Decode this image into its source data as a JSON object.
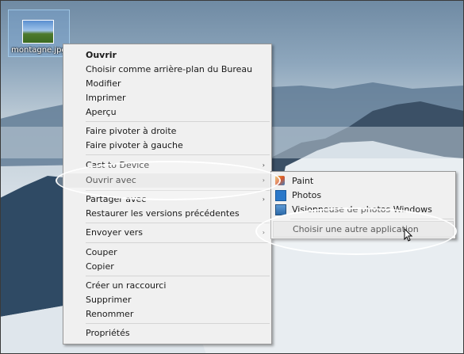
{
  "desktop": {
    "icon_label": "montagne.jpg"
  },
  "context_menu": {
    "items": [
      {
        "label": "Ouvrir",
        "bold": true
      },
      {
        "label": "Choisir comme arrière-plan du Bureau"
      },
      {
        "label": "Modifier"
      },
      {
        "label": "Imprimer"
      },
      {
        "label": "Aperçu"
      },
      {
        "label": "Faire pivoter à droite"
      },
      {
        "label": "Faire pivoter à gauche"
      },
      {
        "label": "Cast to Device",
        "submenu": true
      },
      {
        "label": "Ouvrir avec",
        "submenu": true,
        "highlighted": true
      },
      {
        "label": "Partager avec",
        "submenu": true
      },
      {
        "label": "Restaurer les versions précédentes"
      },
      {
        "label": "Envoyer vers",
        "submenu": true
      },
      {
        "label": "Couper"
      },
      {
        "label": "Copier"
      },
      {
        "label": "Créer un raccourci"
      },
      {
        "label": "Supprimer"
      },
      {
        "label": "Renommer"
      },
      {
        "label": "Propriétés"
      }
    ],
    "submenu_arrow": "›"
  },
  "open_with_menu": {
    "items": [
      {
        "label": "Paint",
        "icon": "paint-icon"
      },
      {
        "label": "Photos",
        "icon": "photos-icon"
      },
      {
        "label": "Visionneuse de photos Windows",
        "icon": "photo-viewer-icon"
      },
      {
        "label": "Choisir une autre application",
        "highlighted": true
      }
    ]
  },
  "colors": {
    "menu_bg": "#f0f0f0",
    "menu_border": "#979797",
    "highlight": "#e3e3e3"
  }
}
